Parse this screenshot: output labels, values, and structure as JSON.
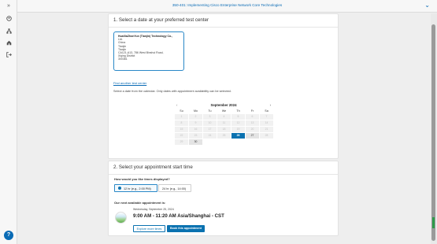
{
  "sidebar": {
    "icons": [
      "expand-icon",
      "user-icon",
      "org-icon",
      "home-icon",
      "signout-icon"
    ],
    "help_label": "?"
  },
  "topbar": {
    "title": "350-401: Implementing Cisco Enterprise Network Core Technologies"
  },
  "section1": {
    "title": "1. Select a date at your preferred test center",
    "center": {
      "name": "HuaXiaZhonYue (Tianjin) Technology Co.,",
      "lines": [
        "Ltd.",
        "China",
        "Tianjin",
        "Tianjin",
        "CA121-A13, 786 West Binshui Road,",
        "Xiqing District",
        "300381"
      ]
    },
    "find_link": "Find another test center",
    "instructions": "Select a date from the calendar. Only dates with appointment availability can be selected.",
    "calendar": {
      "month": "September 2024",
      "prev": "‹",
      "next": "›",
      "dow": [
        "Su",
        "Mo",
        "Tu",
        "We",
        "Th",
        "Fr",
        "Sa"
      ],
      "days": [
        [
          "1",
          "2",
          "3",
          "4",
          "5",
          "6",
          "7"
        ],
        [
          "8",
          "9",
          "10",
          "11",
          "12",
          "13",
          "14"
        ],
        [
          "15",
          "16",
          "17",
          "18",
          "19",
          "20",
          "21"
        ],
        [
          "22",
          "23",
          "24",
          "25",
          "26",
          "27",
          "28"
        ],
        [
          "29",
          "30",
          "",
          "",
          "",
          "",
          ""
        ]
      ],
      "selected": "26",
      "available": [
        "27",
        "30"
      ]
    },
    "why_link": "Why can't I find an available appointment?"
  },
  "section2": {
    "title": "2. Select your appointment start time",
    "time_label": "How would you like times displayed?",
    "opt_12": "12 hr (e.g., 2:00 PM)",
    "opt_24": "24 hr (e.g., 14:00)",
    "next_label": "Our next available appointment is:",
    "next_date": "Wednesday, September 25, 2024",
    "next_time": "9:00 AM - 11:20 AM Asia/Shanghai - CST",
    "btn_explore": "Explore more times",
    "btn_book": "Book this appointment"
  }
}
